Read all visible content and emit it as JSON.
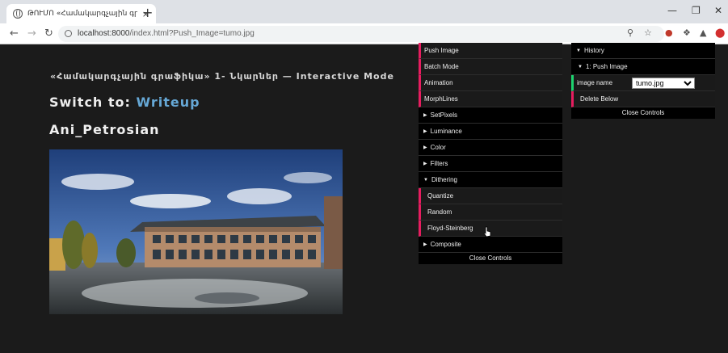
{
  "browser": {
    "tab_title": "ԹՈՒՄՈ «Համակարգչային գրաֆիկա» 1- Նկարներ",
    "tab_close": "×",
    "new_tab": "+",
    "url_host": "localhost:8000",
    "url_path": "/index.html?Push_Image=tumo.jpg"
  },
  "page": {
    "subtitle": "«Համակարգչային գրաֆիկա» 1- Նկարներ — Interactive Mode",
    "switch_prefix": "Switch to: ",
    "switch_link": "Writeup",
    "author": "Ani_Petrosian"
  },
  "gui_main": {
    "items": [
      {
        "label": "Push Image"
      },
      {
        "label": "Batch Mode"
      },
      {
        "label": "Animation"
      },
      {
        "label": "MorphLines"
      },
      {
        "label": "SetPixels"
      },
      {
        "label": "Luminance"
      },
      {
        "label": "Color"
      },
      {
        "label": "Filters"
      },
      {
        "label": "Dithering"
      },
      {
        "label": "Quantize"
      },
      {
        "label": "Random"
      },
      {
        "label": "Floyd-Steinberg"
      },
      {
        "label": "Composite"
      }
    ],
    "close": "Close Controls"
  },
  "gui_history": {
    "title": "History",
    "entry": "1: Push Image",
    "field_label": "image name",
    "field_value": "tumo.jpg",
    "delete": "Delete Below",
    "close": "Close Controls"
  },
  "colors": {
    "func_accent": "#e61d5f",
    "string_accent": "#1ed36f",
    "link": "#66a8d6"
  }
}
